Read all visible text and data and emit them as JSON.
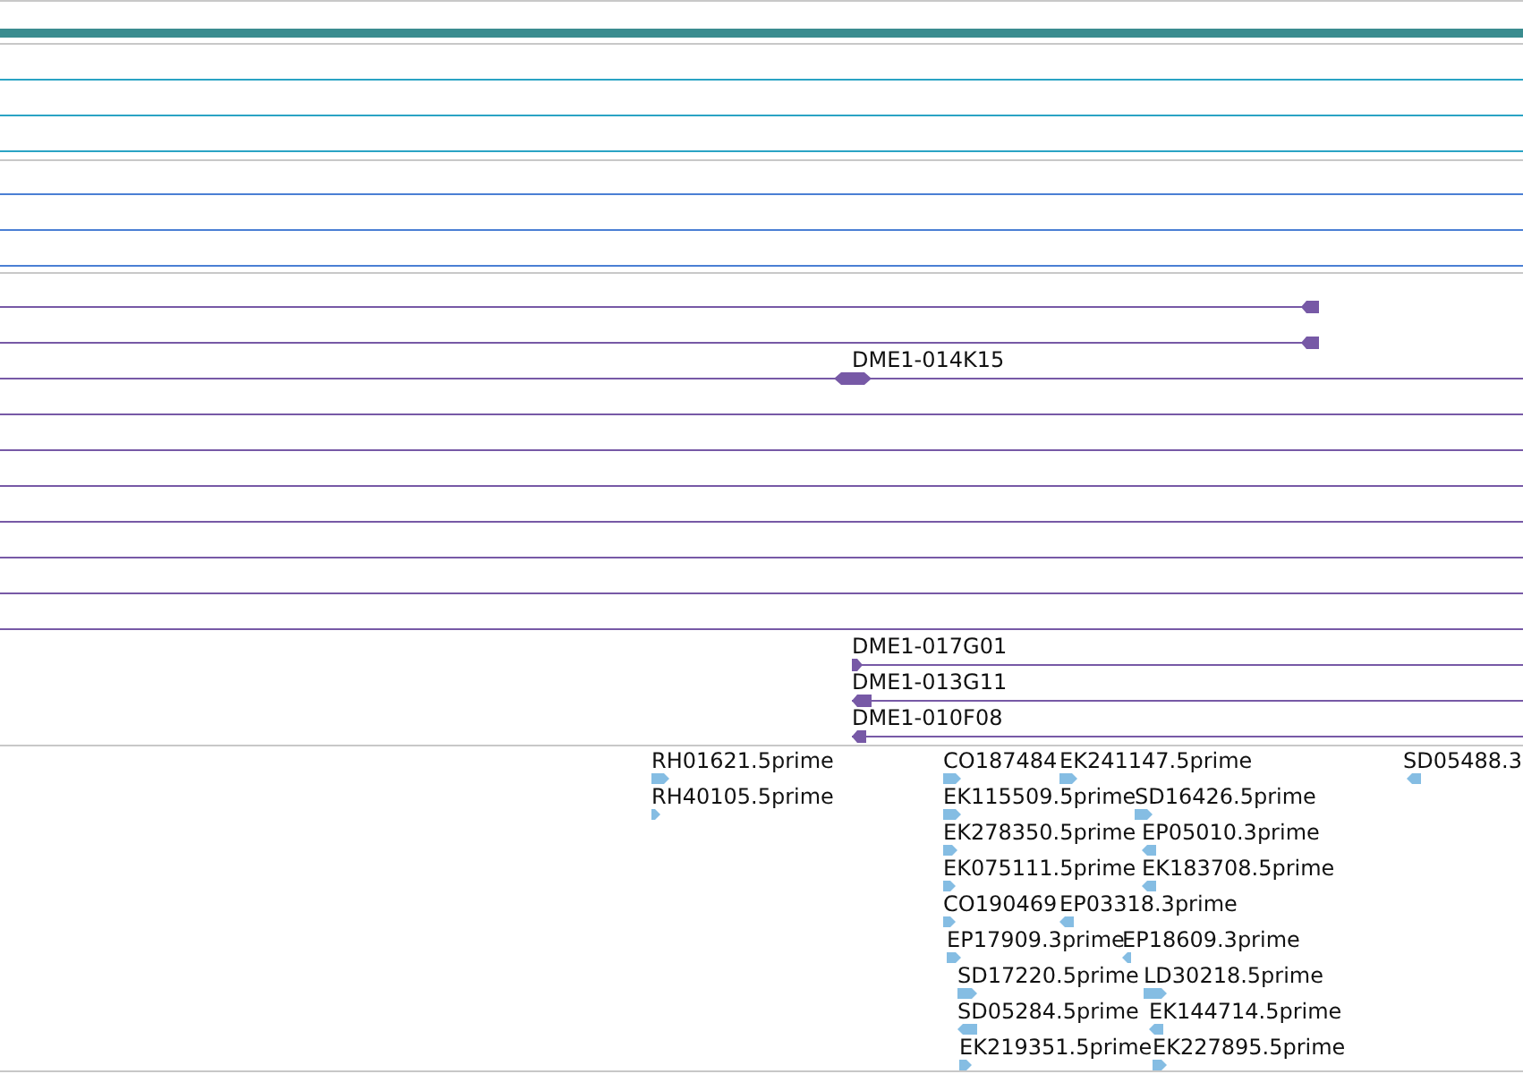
{
  "tracks": [
    {
      "kind": "bar",
      "color": "#3a8c8f"
    },
    {
      "kind": "lines",
      "color": "#2aa3c4"
    },
    {
      "kind": "lines",
      "color": "#4a7fd4"
    },
    {
      "kind": "clones",
      "color": "#7759a6",
      "rows": [
        {
          "kind": "minus"
        },
        {
          "kind": "minus"
        },
        {
          "label": "DME1-014K15",
          "kind": "both"
        },
        {
          "kind": "plain"
        },
        {
          "kind": "plain"
        },
        {
          "kind": "plain"
        },
        {
          "kind": "plain"
        },
        {
          "kind": "plain"
        },
        {
          "kind": "plain"
        },
        {
          "kind": "plain"
        },
        {
          "label": "DME1-017G01",
          "kind": "plus"
        },
        {
          "label": "DME1-013G11",
          "kind": "minus"
        },
        {
          "label": "DME1-010F08",
          "kind": "minus"
        }
      ]
    },
    {
      "kind": "ests",
      "color": "#85bde3",
      "rows": [
        {
          "label": "RH01621.5prime",
          "kind": "plus"
        },
        {
          "label": "CO187484",
          "kind": "plus"
        },
        {
          "label": "EK241147.5prime",
          "kind": "plus"
        },
        {
          "label": "SD05488.3",
          "kind": "minus"
        },
        {
          "label": "RH40105.5prime",
          "kind": "plus"
        },
        {
          "label": "EK115509.5prime",
          "kind": "plus"
        },
        {
          "label": "SD16426.5prime",
          "kind": "plus"
        },
        {
          "label": "EK278350.5prime",
          "kind": "plus"
        },
        {
          "label": "EP05010.3prime",
          "kind": "minus"
        },
        {
          "label": "EK075111.5prime",
          "kind": "plus"
        },
        {
          "label": "EK183708.5prime",
          "kind": "minus"
        },
        {
          "label": "CO190469",
          "kind": "plus"
        },
        {
          "label": "EP03318.3prime",
          "kind": "minus"
        },
        {
          "label": "EP17909.3prime",
          "kind": "plus"
        },
        {
          "label": "EP18609.3prime",
          "kind": "minus"
        },
        {
          "label": "SD17220.5prime",
          "kind": "plus"
        },
        {
          "label": "LD30218.5prime",
          "kind": "plus"
        },
        {
          "label": "SD05284.5prime",
          "kind": "minus"
        },
        {
          "label": "EK144714.5prime",
          "kind": "minus"
        },
        {
          "label": "EK219351.5prime",
          "kind": "plus"
        },
        {
          "label": "EK227895.5prime",
          "kind": "plus"
        }
      ]
    }
  ]
}
